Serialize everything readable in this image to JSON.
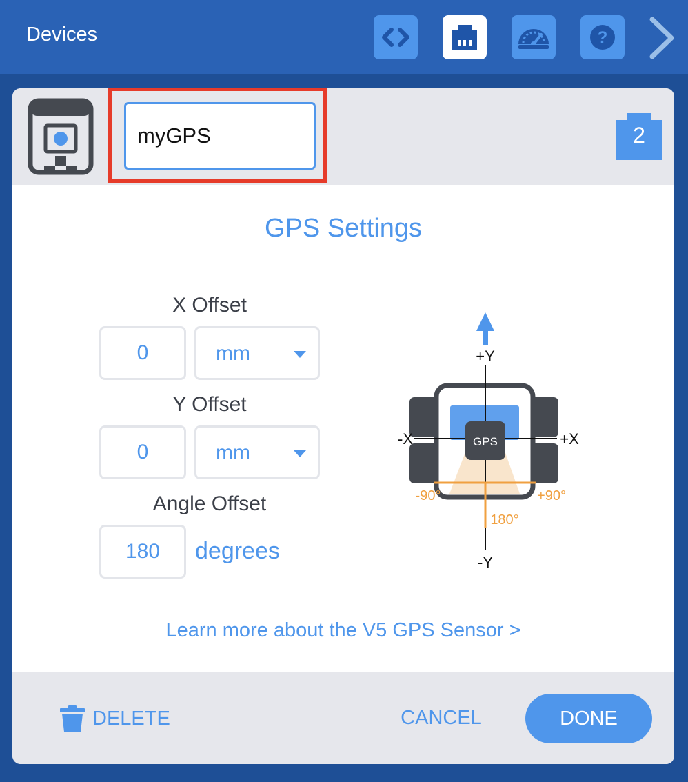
{
  "topbar": {
    "title": "Devices",
    "buttons": [
      {
        "icon": "code-icon",
        "active": false
      },
      {
        "icon": "ethernet-port-icon",
        "active": true
      },
      {
        "icon": "dashboard-gauge-icon",
        "active": false
      },
      {
        "icon": "help-icon",
        "active": false
      }
    ],
    "next_icon": "chevron-right-icon"
  },
  "device": {
    "icon": "gps-sensor-icon",
    "name_value": "myGPS",
    "port": "2"
  },
  "settings": {
    "title": "GPS Settings",
    "x_offset": {
      "label": "X Offset",
      "value": "0",
      "unit": "mm"
    },
    "y_offset": {
      "label": "Y Offset",
      "value": "0",
      "unit": "mm"
    },
    "angle_offset": {
      "label": "Angle Offset",
      "value": "180",
      "unit": "degrees"
    }
  },
  "diagram": {
    "plus_y": "+Y",
    "minus_y": "-Y",
    "plus_x": "+X",
    "minus_x": "-X",
    "sensor": "GPS",
    "angle_left": "-90°",
    "angle_right": "+90°",
    "angle_bottom": "180°"
  },
  "learn_more": "Learn more about the V5 GPS Sensor >",
  "footer": {
    "delete": "DELETE",
    "cancel": "CANCEL",
    "done": "DONE"
  },
  "colors": {
    "accent": "#4f96eb",
    "topbar": "#2a62b5",
    "highlight": "#e63b2a",
    "orange": "#f0a040"
  }
}
